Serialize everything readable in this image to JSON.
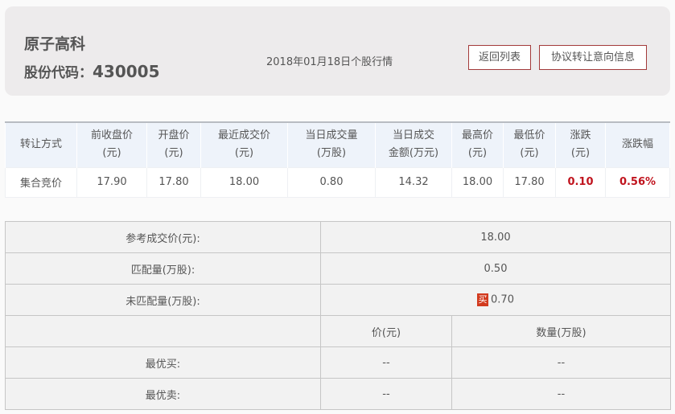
{
  "header": {
    "stock_name": "原子高科",
    "code_label": "股份代码：",
    "code": "430005",
    "date_title": "2018年01月18日个股行情",
    "back_button": "返回列表",
    "agreement_button": "协议转让意向信息"
  },
  "quote_table": {
    "headers": [
      [
        "转让方式",
        ""
      ],
      [
        "前收盘价",
        "(元)"
      ],
      [
        "开盘价",
        "(元)"
      ],
      [
        "最近成交价",
        "(元)"
      ],
      [
        "当日成交量",
        "(万股)"
      ],
      [
        "当日成交",
        "金额(万元)"
      ],
      [
        "最高价",
        "(元)"
      ],
      [
        "最低价",
        "(元)"
      ],
      [
        "涨跌",
        "(元)"
      ],
      [
        "涨跌幅",
        ""
      ]
    ],
    "row": [
      "集合竞价",
      "17.90",
      "17.80",
      "18.00",
      "0.80",
      "14.32",
      "18.00",
      "17.80",
      "0.10",
      "0.56%"
    ]
  },
  "detail_table": {
    "ref_price_label": "参考成交价(元):",
    "ref_price": "18.00",
    "matched_label": "匹配量(万股):",
    "matched": "0.50",
    "unmatched_label": "未匹配量(万股):",
    "unmatched_side": "买",
    "unmatched": "0.70",
    "col_price": "价(元)",
    "col_qty": "数量(万股)",
    "best_buy_label": "最优买:",
    "best_buy_price": "--",
    "best_buy_qty": "--",
    "best_sell_label": "最优卖:",
    "best_sell_price": "--",
    "best_sell_qty": "--"
  },
  "colors": {
    "accent_red": "#c0141e",
    "header_bg": "#eef3fa"
  }
}
